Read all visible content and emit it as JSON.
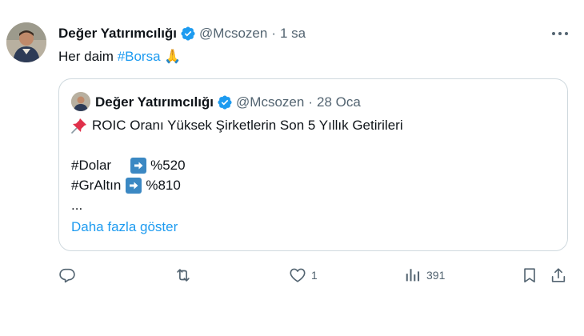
{
  "tweet": {
    "author_name": "Değer Yatırımcılığı",
    "handle": "@Mcsozen",
    "separator": "·",
    "time": "1 sa",
    "text_prefix": "Her daim ",
    "hashtag": "#Borsa",
    "emoji": "🙏"
  },
  "quote": {
    "author_name": "Değer Yatırımcılığı",
    "handle": "@Mcsozen",
    "separator": "·",
    "time": "28 Oca",
    "title": "ROIC Oranı Yüksek Şirketlerin Son 5 Yıllık Getirileri",
    "lines": [
      {
        "tag": "#Dolar",
        "value": "%520"
      },
      {
        "tag": "#GrAltın",
        "value": "%810"
      }
    ],
    "ellipsis": "...",
    "show_more": "Daha fazla göster"
  },
  "actions": {
    "reply_count": "",
    "retweet_count": "",
    "like_count": "1",
    "views_count": "391"
  },
  "colors": {
    "link": "#1d9bf0",
    "secondary_text": "#536471",
    "verified": "#1d9bf0",
    "border": "#cfd9de"
  },
  "icons": {
    "verified": "verified-badge-icon",
    "more": "more-icon",
    "pin": "pushpin-icon",
    "arrow": "right-arrow-icon",
    "reply": "reply-icon",
    "retweet": "retweet-icon",
    "like": "heart-icon",
    "views": "views-icon",
    "bookmark": "bookmark-icon",
    "share": "share-icon"
  }
}
